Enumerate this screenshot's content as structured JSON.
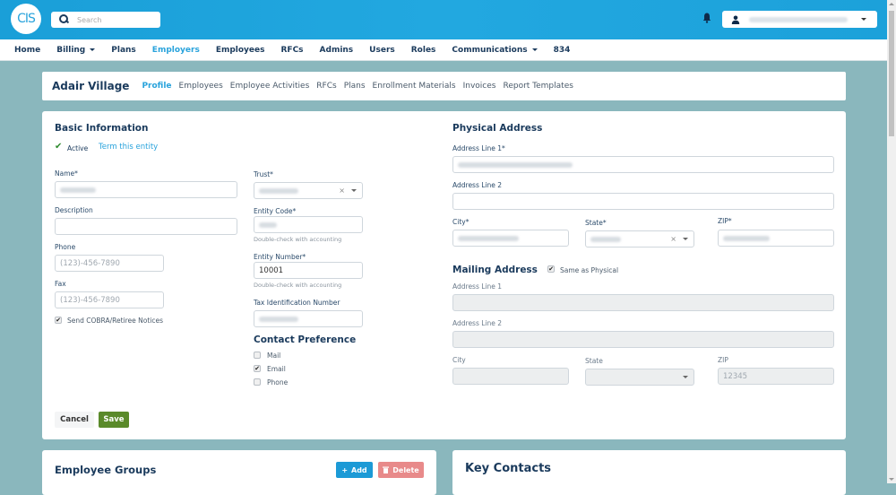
{
  "header": {
    "logo_text": "CIS",
    "search_placeholder": "Search"
  },
  "nav": {
    "items": [
      {
        "label": "Home"
      },
      {
        "label": "Billing",
        "dropdown": true
      },
      {
        "label": "Plans"
      },
      {
        "label": "Employers",
        "active": true
      },
      {
        "label": "Employees"
      },
      {
        "label": "RFCs"
      },
      {
        "label": "Admins"
      },
      {
        "label": "Users"
      },
      {
        "label": "Roles"
      },
      {
        "label": "Communications",
        "dropdown": true
      },
      {
        "label": "834"
      }
    ]
  },
  "subnav": {
    "entity_name": "Adair Village",
    "tabs": [
      "Profile",
      "Employees",
      "Employee Activities",
      "RFCs",
      "Plans",
      "Enrollment Materials",
      "Invoices",
      "Report Templates"
    ]
  },
  "basic_info": {
    "title": "Basic Information",
    "status": "Active",
    "term_link": "Term this entity",
    "name_label": "Name*",
    "description_label": "Description",
    "phone_label": "Phone",
    "phone_placeholder": "(123)-456-7890",
    "fax_label": "Fax",
    "fax_placeholder": "(123)-456-7890",
    "cobra_label": "Send COBRA/Retiree Notices",
    "trust_label": "Trust*",
    "entity_code_label": "Entity Code*",
    "entity_code_help": "Double-check with accounting",
    "entity_number_label": "Entity Number*",
    "entity_number_value": "10001",
    "entity_number_help": "Double-check with accounting",
    "tax_id_label": "Tax Identification Number"
  },
  "contact_preference": {
    "title": "Contact Preference",
    "options": [
      {
        "label": "Mail",
        "checked": false
      },
      {
        "label": "Email",
        "checked": true
      },
      {
        "label": "Phone",
        "checked": false
      }
    ]
  },
  "physical_address": {
    "title": "Physical Address",
    "line1_label": "Address Line 1*",
    "line2_label": "Address Line 2",
    "city_label": "City*",
    "state_label": "State*",
    "zip_label": "ZIP*"
  },
  "mailing_address": {
    "title": "Mailing Address",
    "same_as_label": "Same as Physical",
    "line1_label": "Address Line 1",
    "line2_label": "Address Line 2",
    "city_label": "City",
    "state_label": "State",
    "zip_label": "ZIP",
    "zip_placeholder": "12345"
  },
  "actions": {
    "cancel": "Cancel",
    "save": "Save"
  },
  "employee_groups": {
    "title": "Employee Groups",
    "add": "Add",
    "delete": "Delete"
  },
  "key_contacts": {
    "title": "Key Contacts"
  }
}
